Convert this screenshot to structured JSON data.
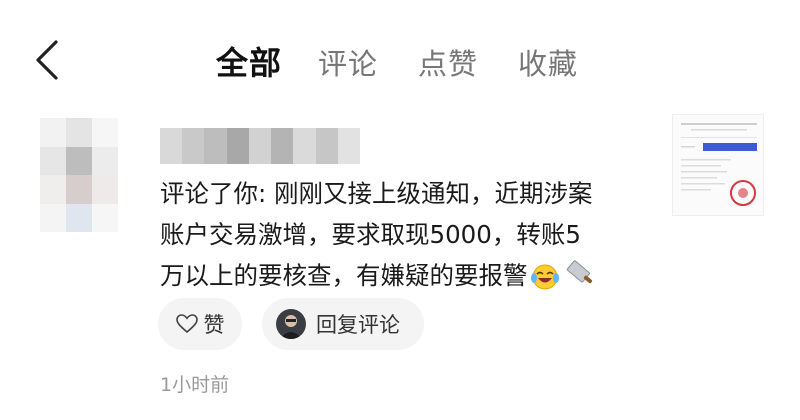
{
  "header": {
    "back_icon": "chevron-left-icon",
    "tabs": [
      {
        "label": "全部",
        "active": true
      },
      {
        "label": "评论",
        "active": false
      },
      {
        "label": "点赞",
        "active": false
      },
      {
        "label": "收藏",
        "active": false
      }
    ]
  },
  "notification": {
    "comment_lines": [
      "评论了你: 刚刚又接上级通知，近期涉案",
      "账户交易激增，要求取现5000，转账5",
      "万以上的要核查，有嫌疑的要报警"
    ],
    "emojis": [
      "laughing-crying-emoji",
      "cleaver-knife-emoji"
    ],
    "like_label": "赞",
    "reply_label": "回复评论",
    "time": "1小时前"
  },
  "colors": {
    "active_tab": "#111111",
    "inactive_tab": "#777777",
    "pill_bg": "#f4f4f5",
    "time_text": "#9a9a9a"
  }
}
